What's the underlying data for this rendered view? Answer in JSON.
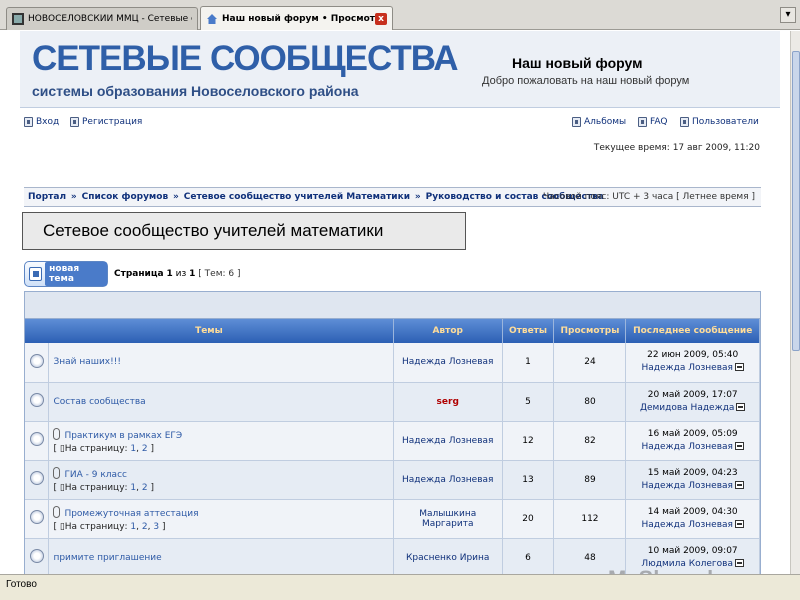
{
  "browser": {
    "tabs": [
      {
        "label": "НОВОСЕЛОВСКИЙ ММЦ - Сетевые со..."
      },
      {
        "label": "Наш новый форум • Просмотр ф..."
      }
    ],
    "tab_close": "x",
    "window_btn": "▾",
    "status": "Готово"
  },
  "banner": {
    "title": "СЕТЕВЫЕ СООБЩЕСТВА",
    "subtitle": "системы образования Новоселовского района",
    "forum_name": "Наш новый форум",
    "forum_desc": "Добро пожаловать на наш новый форум"
  },
  "nav": {
    "login": "Вход",
    "register": "Регистрация",
    "albums": "Альбомы",
    "faq": "FAQ",
    "users": "Пользователи",
    "current_time": "Текущее время: 17 авг 2009, 11:20"
  },
  "breadcrumb": {
    "items": [
      "Портал",
      "Список форумов",
      "Сетевое сообщество учителей Математики",
      "Руководство и состав сообщества"
    ],
    "separator": "»",
    "timezone": "Часовой пояс: UTC + 3 часа [ Летнее время ]"
  },
  "overlay_title": "Сетевое сообщество учителей математики",
  "toolbar": {
    "new_topic": "новая тема",
    "page_prefix": "Страница",
    "page_current": "1",
    "page_of": "из",
    "page_total": "1",
    "topics_count": "[ Тем: 6 ]"
  },
  "table": {
    "headers": {
      "topics": "Темы",
      "author": "Автор",
      "replies": "Ответы",
      "views": "Просмотры",
      "last": "Последнее сообщение"
    },
    "pages_label": "На страницу:",
    "rows": [
      {
        "title": "Знай наших!!!",
        "author": "Надежда Лозневая",
        "replies": "1",
        "views": "24",
        "last_date": "22 июн 2009, 05:40",
        "last_by": "Надежда Лозневая"
      },
      {
        "title": "Состав сообщества",
        "author": "serg",
        "replies": "5",
        "views": "80",
        "last_date": "20 май 2009, 17:07",
        "last_by": "Демидова Надежда"
      },
      {
        "title": "Практикум в рамках ЕГЭ",
        "pages": [
          "1",
          "2"
        ],
        "author": "Надежда Лозневая",
        "replies": "12",
        "views": "82",
        "last_date": "16 май 2009, 05:09",
        "last_by": "Надежда Лозневая"
      },
      {
        "title": "ГИА - 9 класс",
        "pages": [
          "1",
          "2"
        ],
        "author": "Надежда Лозневая",
        "replies": "13",
        "views": "89",
        "last_date": "15 май 2009, 04:23",
        "last_by": "Надежда Лозневая"
      },
      {
        "title": "Промежуточная аттестация",
        "pages": [
          "1",
          "2",
          "3"
        ],
        "author": "Малышкина Маргарита",
        "replies": "20",
        "views": "112",
        "last_date": "14 май 2009, 04:30",
        "last_by": "Надежда Лозневая"
      },
      {
        "title": "примите приглашение",
        "author": "Красненко Ирина",
        "replies": "6",
        "views": "48",
        "last_date": "10 май 2009, 09:07",
        "last_by": "Людмила Колегова"
      }
    ]
  },
  "watermark": "MyShared"
}
